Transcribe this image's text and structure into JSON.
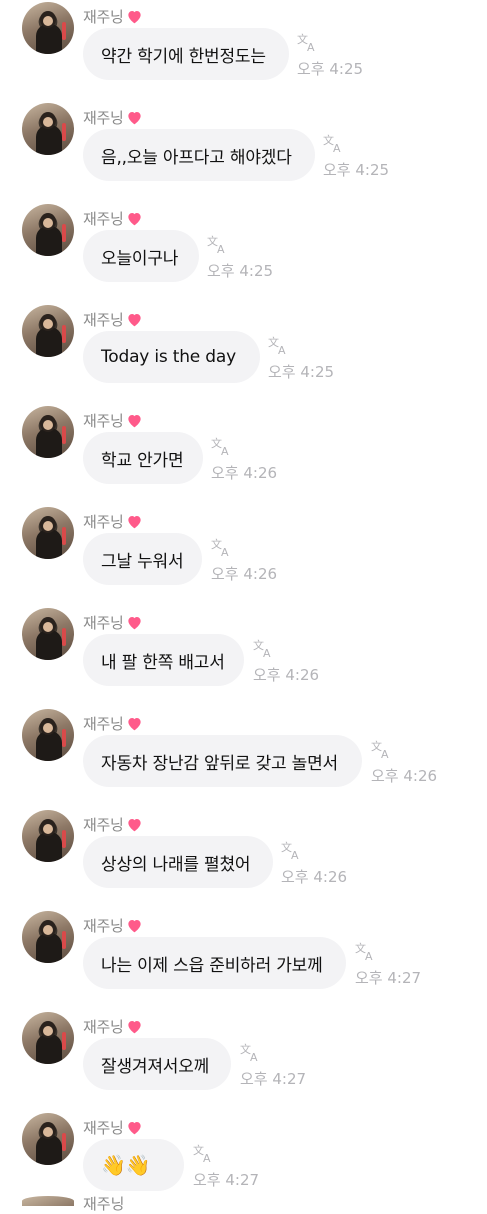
{
  "sender": {
    "name": "재주닝",
    "heart_color": "#ff5a8a"
  },
  "messages": [
    {
      "text": "약간 학기에 한번정도는",
      "time": "오후 4:25"
    },
    {
      "text": "음,,오늘 아프다고 해야겠다",
      "time": "오후 4:25"
    },
    {
      "text": "오늘이구나",
      "time": "오후 4:25"
    },
    {
      "text": "Today is the day",
      "time": "오후 4:25"
    },
    {
      "text": "학교 안가면",
      "time": "오후 4:26"
    },
    {
      "text": "그날 누워서",
      "time": "오후 4:26"
    },
    {
      "text": "내 팔 한쪽 배고서",
      "time": "오후 4:26"
    },
    {
      "text": "자동차 장난감 앞뒤로 갖고 놀면서",
      "time": "오후 4:26"
    },
    {
      "text": "상상의 나래를 펼쳤어",
      "time": "오후 4:26"
    },
    {
      "text": "나는 이제 스읍 준비하러 가보께",
      "time": "오후 4:27"
    },
    {
      "text": "잘생겨져서오께",
      "time": "오후 4:27"
    },
    {
      "text": "👋👋",
      "time": "오후 4:27"
    }
  ],
  "partial_next": {
    "name": "재주닝"
  },
  "icons": {
    "translate": "translate-icon",
    "heart": "heart-icon"
  }
}
